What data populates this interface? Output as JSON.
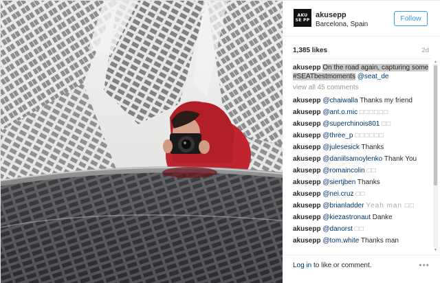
{
  "header": {
    "username": "akusepp",
    "location": "Barcelona, Spain",
    "follow_label": "Follow",
    "avatar_text": "AKU SE PP"
  },
  "post": {
    "likes": "1,385 likes",
    "age": "2d"
  },
  "caption": {
    "username": "akusepp",
    "text_highlighted": "On the road again, capturing some #SEATbestmoments",
    "mention": "@seat_de"
  },
  "view_all": "view all 45 comments",
  "comments": [
    {
      "user": "akusepp",
      "mention": "@chaiwalla",
      "text": "Thanks my friend"
    },
    {
      "user": "akusepp",
      "mention": "@ant.o.mic",
      "text": "□□□□□□"
    },
    {
      "user": "akusepp",
      "mention": "@superchinois801",
      "text": "□□"
    },
    {
      "user": "akusepp",
      "mention": "@three_p",
      "text": "□□□□□□"
    },
    {
      "user": "akusepp",
      "mention": "@julesesick",
      "text": "Thanks"
    },
    {
      "user": "akusepp",
      "mention": "@daniilsamoylenko",
      "text": "Thank You"
    },
    {
      "user": "akusepp",
      "mention": "@romaincolin",
      "text": "□□"
    },
    {
      "user": "akusepp",
      "mention": "@siertjben",
      "text": "Thanks"
    },
    {
      "user": "akusepp",
      "mention": "@nei.cruz",
      "text": "□□"
    },
    {
      "user": "akusepp",
      "mention": "@brianladder",
      "text": "Yeah man □□"
    },
    {
      "user": "akusepp",
      "mention": "@kiezastronaut",
      "text": "Danke"
    },
    {
      "user": "akusepp",
      "mention": "@danorst",
      "text": "□□"
    },
    {
      "user": "akusepp",
      "mention": "@tom.white",
      "text": "Thanks man"
    }
  ],
  "footer": {
    "login_link": "Log in",
    "login_rest": " to like or comment.",
    "more_icon": "ellipsis-icon"
  },
  "colors": {
    "link": "#003569",
    "follow": "#3897f0",
    "hoodie": "#c0242e"
  }
}
